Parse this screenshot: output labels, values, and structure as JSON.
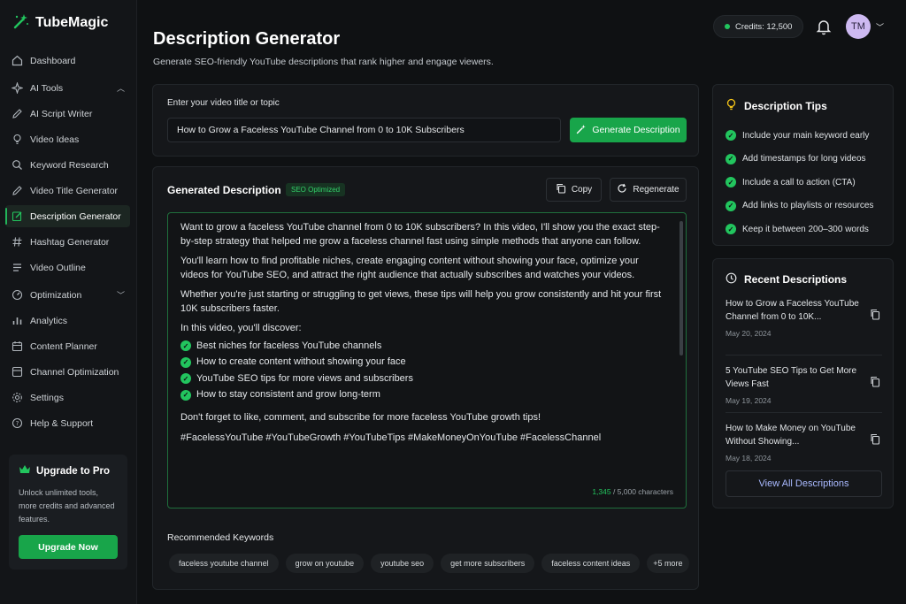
{
  "app": {
    "name": "TubeMagic"
  },
  "sidebar": {
    "items": [
      {
        "label": "Dashboard",
        "icon": "home-icon"
      },
      {
        "label": "AI Tools",
        "icon": "ai-icon"
      },
      {
        "label": "AI Script Writer",
        "icon": "pen-icon"
      },
      {
        "label": "Video Ideas",
        "icon": "bulb-icon"
      },
      {
        "label": "Keyword Research",
        "icon": "search-icon"
      },
      {
        "label": "Video Title Generator",
        "icon": "pen-icon"
      },
      {
        "label": "Description Generator",
        "icon": "edit-icon"
      },
      {
        "label": "Hashtag Generator",
        "icon": "hash-icon"
      },
      {
        "label": "Video Outline",
        "icon": "list-icon"
      },
      {
        "label": "Optimization",
        "icon": "gauge-icon"
      },
      {
        "label": "Analytics",
        "icon": "bars-icon"
      },
      {
        "label": "Content Planner",
        "icon": "calendar-icon"
      },
      {
        "label": "Channel Optimization",
        "icon": "box-icon"
      },
      {
        "label": "Settings",
        "icon": "gear-icon"
      },
      {
        "label": "Help & Support",
        "icon": "help-icon"
      }
    ],
    "upgrade": {
      "title": "Upgrade to Pro",
      "desc": "Unlock unlimited tools, more credits and advanced features.",
      "button": "Upgrade Now"
    }
  },
  "topbar": {
    "credits": "Credits: 12,500",
    "avatar": "TM"
  },
  "page": {
    "title": "Description Generator",
    "subtitle": "Generate SEO-friendly YouTube descriptions that rank higher and engage viewers."
  },
  "input": {
    "label": "Enter your video title or topic",
    "value": "How to Grow a Faceless YouTube Channel from 0 to 10K Subscribers",
    "button": "Generate Description"
  },
  "output": {
    "title": "Generated Description",
    "badge": "SEO Optimized",
    "copy": "Copy",
    "regenerate": "Regenerate",
    "p1": "Want to grow a faceless YouTube channel from 0 to 10K subscribers? In this video, I'll show you the exact step-by-step strategy that helped me grow a faceless channel fast using simple methods that anyone can follow.",
    "p2": "You'll learn how to find profitable niches, create engaging content without showing your face, optimize your videos for YouTube SEO, and attract the right audience that actually subscribes and watches your videos.",
    "p3": "Whether you're just starting or struggling to get views, these tips will help you grow consistently and hit your first 10K subscribers faster.",
    "discover": "In this video, you'll discover:",
    "bullets": [
      "Best niches for faceless YouTube channels",
      "How to create content without showing your face",
      "YouTube SEO tips for more views and subscribers",
      "How to stay consistent and grow long-term"
    ],
    "cta": "Don't forget to like, comment, and subscribe for more faceless YouTube growth tips!",
    "hashtags": "#FacelessYouTube #YouTubeGrowth #YouTubeTips #MakeMoneyOnYouTube #FacelessChannel",
    "char_count": "1,345",
    "char_limit": " / 5,000 characters"
  },
  "keywords": {
    "title": "Recommended Keywords",
    "items": [
      "faceless youtube channel",
      "grow on youtube",
      "youtube seo",
      "get more subscribers",
      "faceless content ideas"
    ],
    "more": "+5 more"
  },
  "tips": {
    "title": "Description Tips",
    "items": [
      "Include your main keyword early",
      "Add timestamps for long videos",
      "Include a call to action (CTA)",
      "Add links to playlists or resources",
      "Keep it between 200–300 words"
    ]
  },
  "recent": {
    "title": "Recent Descriptions",
    "items": [
      {
        "title": "How to Grow a Faceless YouTube Channel from 0 to 10K...",
        "date": "May 20, 2024"
      },
      {
        "title": "5 YouTube SEO Tips to Get More Views Fast",
        "date": "May 19, 2024"
      },
      {
        "title": "How to Make Money on YouTube Without Showing...",
        "date": "May 18, 2024"
      }
    ],
    "view_all": "View All Descriptions"
  },
  "colors": {
    "accent": "#18a54a",
    "accent_bright": "#22c55e",
    "background": "#0f1113",
    "link": "#a9b9ff"
  }
}
